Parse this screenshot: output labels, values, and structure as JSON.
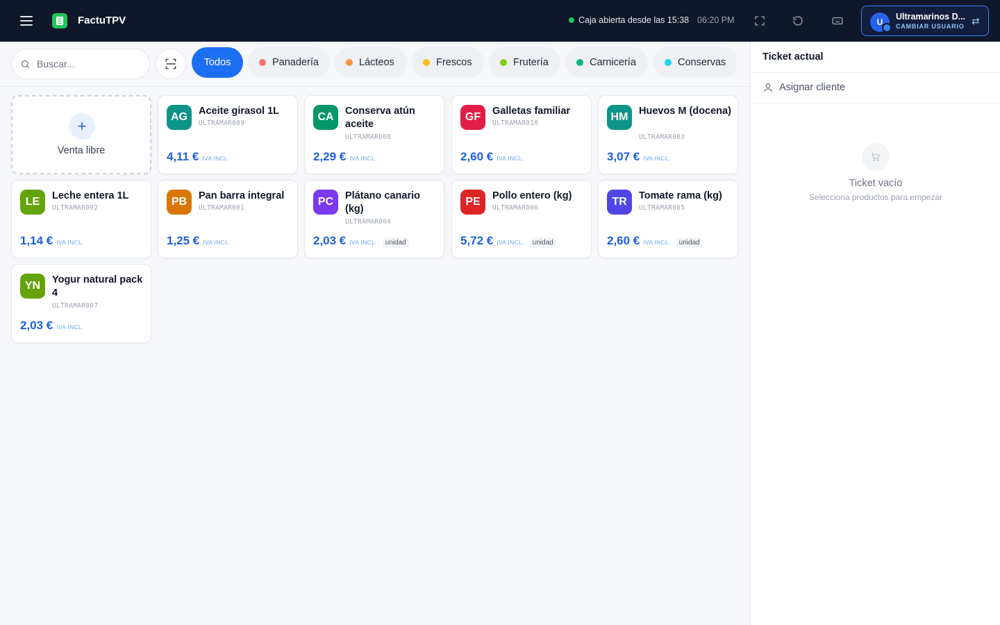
{
  "header": {
    "brand": "FactuTPV",
    "status_text": "Caja abierta desde las 15:38",
    "clock": "06:20 PM",
    "user": {
      "initial": "U",
      "name": "Ultramarinos D...",
      "action": "CAMBIAR USUARIO"
    }
  },
  "search": {
    "placeholder": "Buscar..."
  },
  "categories": [
    {
      "label": "Todos",
      "color": "",
      "active": true
    },
    {
      "label": "Panadería",
      "color": "#f87171",
      "active": false
    },
    {
      "label": "Lácteos",
      "color": "#fb923c",
      "active": false
    },
    {
      "label": "Frescos",
      "color": "#fbbf24",
      "active": false
    },
    {
      "label": "Frutería",
      "color": "#84cc16",
      "active": false
    },
    {
      "label": "Carnicería",
      "color": "#10b981",
      "active": false
    },
    {
      "label": "Conservas",
      "color": "#22d3ee",
      "active": false
    }
  ],
  "free_sale": {
    "label": "Venta libre"
  },
  "products": [
    {
      "initials": "AG",
      "name": "Aceite girasol 1L",
      "sku": "ULTRAMAR009",
      "price": "4,11 €",
      "tax": "IVA INCL.",
      "unit": "",
      "color": "#0d9488"
    },
    {
      "initials": "CA",
      "name": "Conserva atún aceite",
      "sku": "ULTRAMAR008",
      "price": "2,29 €",
      "tax": "IVA INCL.",
      "unit": "",
      "color": "#059669"
    },
    {
      "initials": "GF",
      "name": "Galletas familiar",
      "sku": "ULTRAMAR010",
      "price": "2,60 €",
      "tax": "IVA INCL.",
      "unit": "",
      "color": "#e11d48"
    },
    {
      "initials": "HM",
      "name": "Huevos M (docena)",
      "sku": "ULTRAMAR003",
      "price": "3,07 €",
      "tax": "IVA INCL.",
      "unit": "",
      "color": "#0d9488"
    },
    {
      "initials": "LE",
      "name": "Leche entera 1L",
      "sku": "ULTRAMAR002",
      "price": "1,14 €",
      "tax": "IVA INCL.",
      "unit": "",
      "color": "#65a30d"
    },
    {
      "initials": "PB",
      "name": "Pan barra integral",
      "sku": "ULTRAMAR001",
      "price": "1,25 €",
      "tax": "IVA INCL.",
      "unit": "",
      "color": "#d97706"
    },
    {
      "initials": "PC",
      "name": "Plátano canario (kg)",
      "sku": "ULTRAMAR004",
      "price": "2,03 €",
      "tax": "IVA INCL.",
      "unit": "unidad",
      "color": "#7c3aed"
    },
    {
      "initials": "PE",
      "name": "Pollo entero (kg)",
      "sku": "ULTRAMAR006",
      "price": "5,72 €",
      "tax": "IVA INCL.",
      "unit": "unidad",
      "color": "#dc2626"
    },
    {
      "initials": "TR",
      "name": "Tomate rama (kg)",
      "sku": "ULTRAMAR005",
      "price": "2,60 €",
      "tax": "IVA INCL.",
      "unit": "unidad",
      "color": "#4f46e5"
    },
    {
      "initials": "YN",
      "name": "Yogur natural pack 4",
      "sku": "ULTRAMAR007",
      "price": "2,03 €",
      "tax": "IVA INCL.",
      "unit": "",
      "color": "#65a30d"
    }
  ],
  "ticket": {
    "title": "Ticket actual",
    "assign_client": "Asignar cliente",
    "empty_title": "Ticket vacío",
    "empty_sub": "Selecciona productos para empezar"
  },
  "icons": {
    "menu": "hamburger-icon",
    "fullscreen": "fullscreen-icon",
    "refresh": "refresh-icon",
    "keyboard": "keyboard-icon",
    "swap": "swap-icon",
    "search": "search-icon",
    "scan": "barcode-scan-icon",
    "user": "user-icon",
    "cart": "cart-icon"
  }
}
